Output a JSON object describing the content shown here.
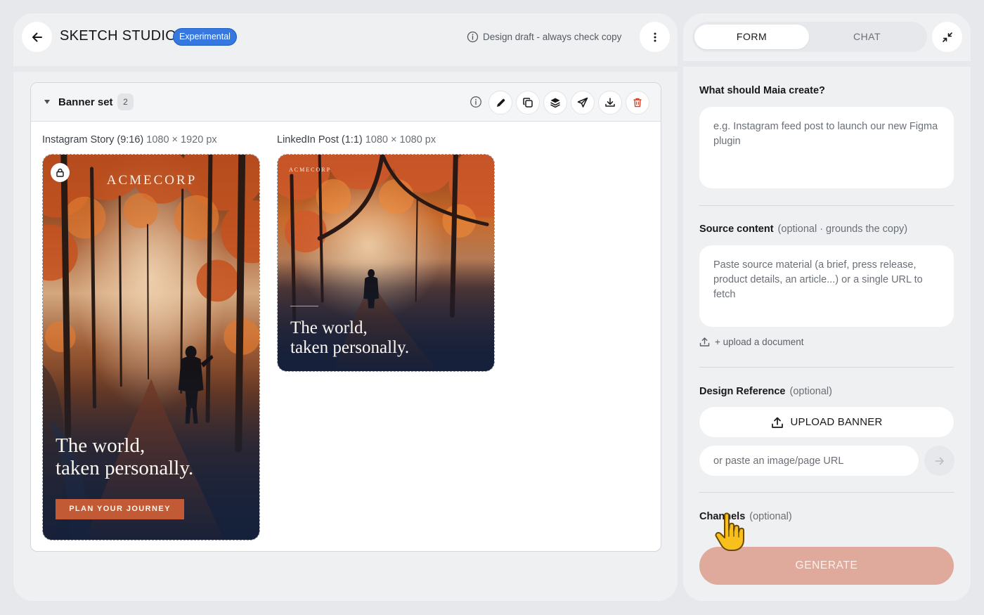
{
  "header": {
    "title": "SKETCH STUDIO",
    "badge": "Experimental",
    "draft_note": "Design draft - always check copy"
  },
  "banner_set": {
    "title": "Banner set",
    "count": "2",
    "variants": [
      {
        "label": "Instagram Story (9:16)",
        "size": "1080 × 1920 px",
        "brand": "ACMECORP",
        "tagline_1": "The world,",
        "tagline_2": "taken personally.",
        "cta": "PLAN YOUR JOURNEY"
      },
      {
        "label": "LinkedIn Post (1:1)",
        "size": "1080 × 1080 px",
        "brand": "ACMECORP",
        "tagline_1": "The world,",
        "tagline_2": "taken personally."
      }
    ]
  },
  "panel": {
    "tabs": [
      "FORM",
      "CHAT"
    ],
    "active_tab": "FORM",
    "create_label": "What should Maia create?",
    "create_placeholder": "e.g. Instagram feed post to launch our new Figma plugin",
    "source_label": "Source content",
    "source_optional": "(optional · grounds the copy)",
    "source_placeholder": "Paste source material (a brief, press release, product details, an article...) or a single URL to fetch",
    "upload_document": "+ upload a document",
    "design_ref_label": "Design Reference",
    "design_ref_optional": "(optional)",
    "upload_banner": "UPLOAD BANNER",
    "url_placeholder": "or paste an image/page URL",
    "channels_label": "Channels",
    "channels_optional": "(optional)",
    "generate": "GENERATE"
  },
  "colors": {
    "accent_badge": "#3478e0",
    "cta": "#c25a35",
    "generate_disabled": "#dfaa9b",
    "delete_icon": "#d9442b"
  },
  "icons": [
    "arrow-left-icon",
    "more-vertical-icon",
    "info-icon",
    "pencil-icon",
    "copy-icon",
    "layers-icon",
    "send-icon",
    "download-icon",
    "trash-icon",
    "lock-icon",
    "collapse-icon",
    "upload-icon",
    "arrow-right-icon",
    "hand-pointer-icon"
  ]
}
